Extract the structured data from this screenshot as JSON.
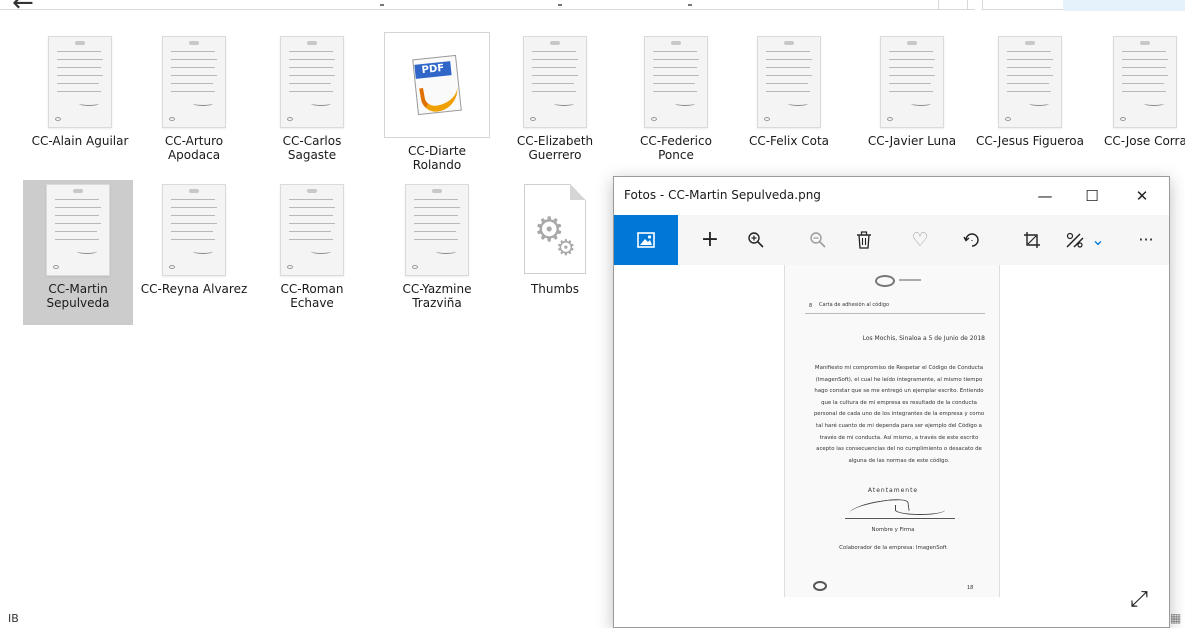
{
  "explorer": {
    "files": [
      {
        "name": "CC-Alain Aguilar",
        "kind": "doc-thumbnail"
      },
      {
        "name": "CC-Arturo Apodaca",
        "kind": "doc-thumbnail"
      },
      {
        "name": "CC-Carlos Sagaste",
        "kind": "doc-thumbnail"
      },
      {
        "name": "CC-Diarte Rolando",
        "kind": "pdf"
      },
      {
        "name": "CC-Elizabeth Guerrero",
        "kind": "doc-thumbnail"
      },
      {
        "name": "CC-Federico Ponce",
        "kind": "doc-thumbnail"
      },
      {
        "name": "CC-Felix Cota",
        "kind": "doc-thumbnail"
      },
      {
        "name": "CC-Javier Luna",
        "kind": "doc-thumbnail"
      },
      {
        "name": "CC-Jesus Figueroa",
        "kind": "doc-thumbnail"
      },
      {
        "name": "CC-Jose Corra",
        "kind": "doc-thumbnail"
      },
      {
        "name": "CC-Martin Sepulveda",
        "kind": "doc-thumbnail",
        "selected": true
      },
      {
        "name": "CC-Reyna Alvarez",
        "kind": "doc-thumbnail"
      },
      {
        "name": "CC-Roman Echave",
        "kind": "doc-thumbnail"
      },
      {
        "name": "CC-Yazmine Trazviña",
        "kind": "doc-thumbnail"
      },
      {
        "name": "Thumbs",
        "kind": "system-file"
      }
    ],
    "pdf_badge": "PDF",
    "status_left": "IB"
  },
  "photos": {
    "title": "Fotos - CC-Martin Sepulveda.png",
    "window_buttons": {
      "minimize": "—",
      "maximize": "☐",
      "close": "✕"
    },
    "toolbar": {
      "image": "image-icon",
      "add": "+",
      "zoom_in": "zoom-in-icon",
      "zoom_out": "zoom-out-icon",
      "delete": "trash-icon",
      "favorite": "♡",
      "rotate": "rotate-icon",
      "crop": "crop-icon",
      "edit": "edit-icon",
      "edit_chevron": "⌄",
      "more": "···"
    },
    "accent": "#0078d7",
    "document": {
      "number": "8",
      "heading": "Carta de adhesión al código",
      "date": "Los Mochis, Sinaloa a  5  de  Junio  de  2018",
      "body": "Manifiesto mi compromiso de Respetar el Código de Conducta (ImagenSoft), el cual he leído íntegramente, al mismo tiempo hago constar que se me entregó un ejemplar escrito. Entiendo que la cultura de mi empresa es resultado de la conducta personal de cada uno de los integrantes de la empresa y como tal haré cuanto de mi dependa para ser ejemplo del Código a través de mi conducta. Así mismo, a través de este escrito acepto las consecuencias del no cumplimiento o desacato de alguna de las normas de este código.",
      "closing": "Atentamente",
      "name_line": "Nombre y Firma",
      "collaborator": "Colaborador de la empresa: ImagenSoft",
      "page": "18"
    },
    "expand": "⤢"
  }
}
